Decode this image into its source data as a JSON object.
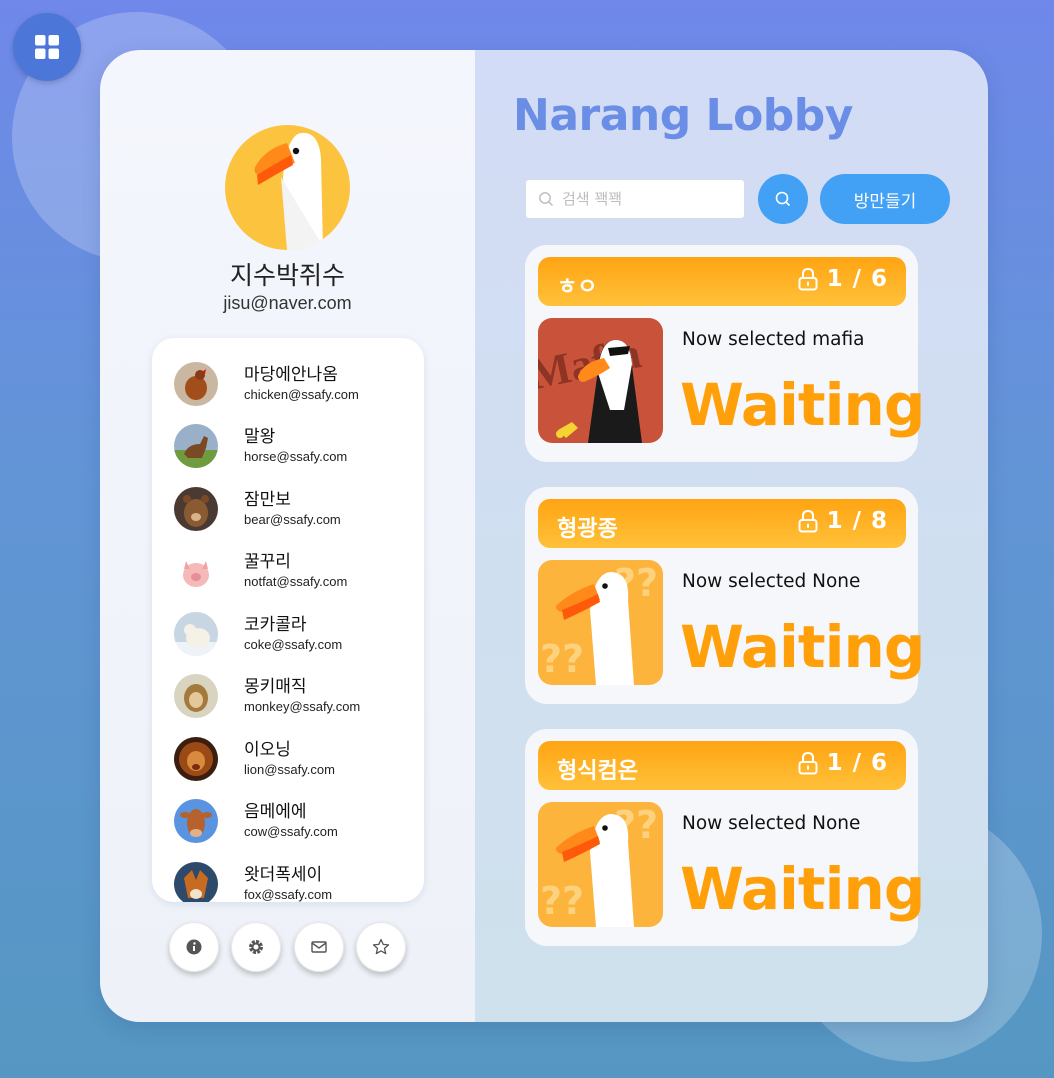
{
  "profile": {
    "name": "지수박쥐수",
    "email": "jisu@naver.com"
  },
  "friends": [
    {
      "name": "마당에안나옴",
      "email": "chicken@ssafy.com"
    },
    {
      "name": "말왕",
      "email": "horse@ssafy.com"
    },
    {
      "name": "잠만보",
      "email": "bear@ssafy.com"
    },
    {
      "name": "꿀꾸리",
      "email": "notfat@ssafy.com"
    },
    {
      "name": "코카콜라",
      "email": "coke@ssafy.com"
    },
    {
      "name": "몽키매직",
      "email": "monkey@ssafy.com"
    },
    {
      "name": "이오닝",
      "email": "lion@ssafy.com"
    },
    {
      "name": "음메에에",
      "email": "cow@ssafy.com"
    },
    {
      "name": "왓더폭세이",
      "email": "fox@ssafy.com"
    }
  ],
  "bottom_icons": [
    "info-icon",
    "gear-icon",
    "mail-icon",
    "star-icon"
  ],
  "lobby": {
    "title": "Narang Lobby",
    "search_placeholder": "검색 꽥꽥",
    "make_room_label": "방만들기"
  },
  "rooms": [
    {
      "name": "ㅎㅇ",
      "count": "1 / 6",
      "selected": "Now selected mafia",
      "status": "Waiting",
      "thumb_text": "Mafia"
    },
    {
      "name": "형광종",
      "count": "1 / 8",
      "selected": "Now selected None",
      "status": "Waiting"
    },
    {
      "name": "형식컴온",
      "count": "1 / 6",
      "selected": "Now selected None",
      "status": "Waiting"
    }
  ],
  "colors": {
    "accent": "#42a0f5",
    "title": "#6a8de6",
    "room_header": "#ffa412",
    "status": "#ffa00a"
  }
}
